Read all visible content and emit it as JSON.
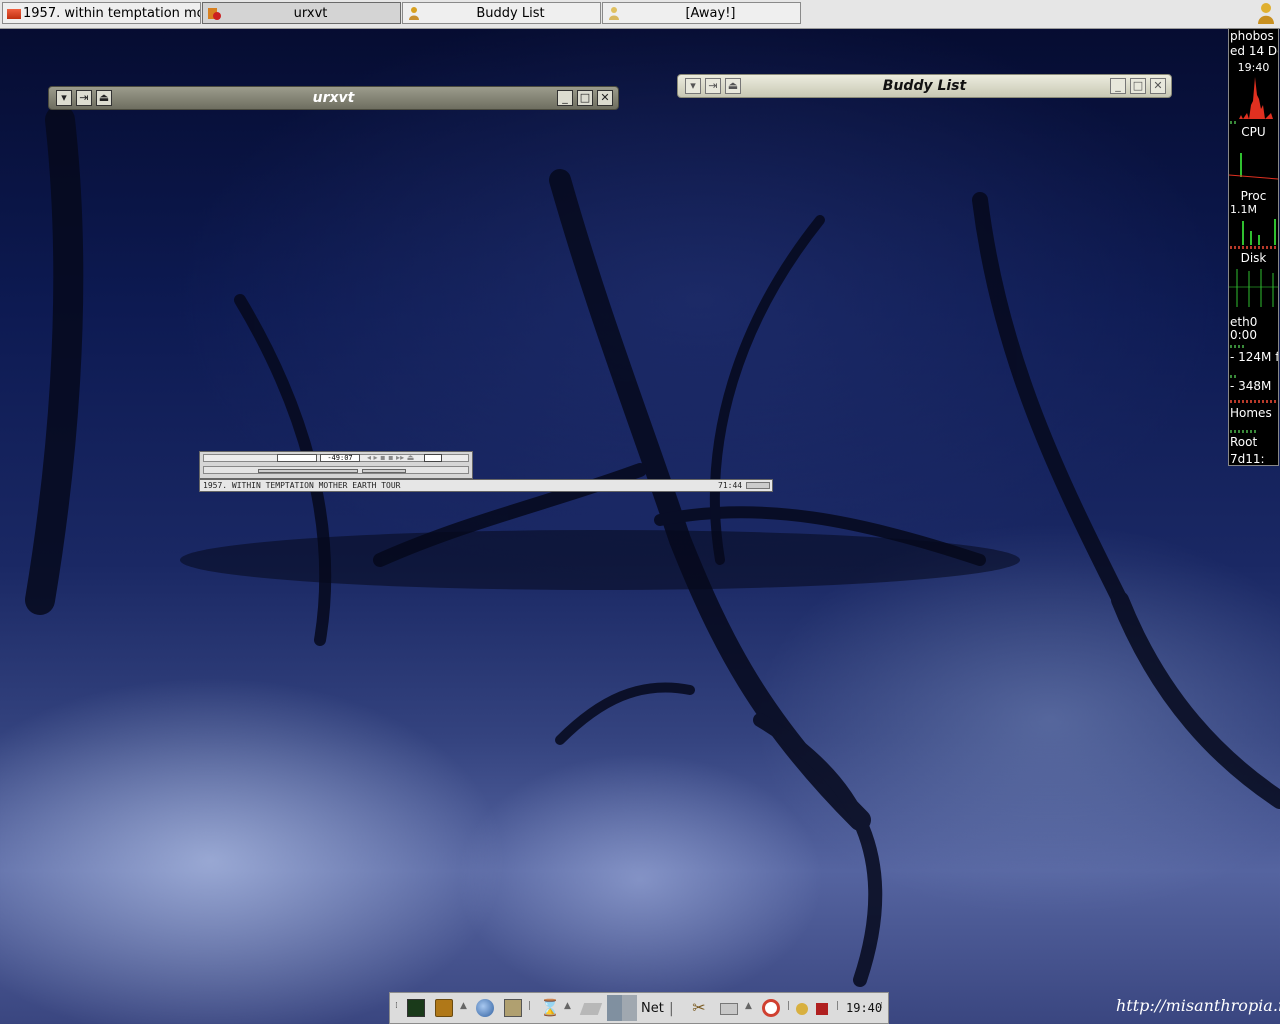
{
  "taskbar": {
    "tasks": [
      {
        "label": "1957. within temptation mothe",
        "icon": "xmms-icon"
      },
      {
        "label": "urxvt",
        "icon": "terminal-icon"
      },
      {
        "label": "Buddy List",
        "icon": "buddy-icon"
      },
      {
        "label": "[Away!]",
        "icon": "buddy-icon"
      }
    ]
  },
  "windows": {
    "urxvt": {
      "title": "urxvt"
    },
    "buddy": {
      "title": "Buddy List"
    }
  },
  "gkrellm": {
    "host": "phobos",
    "date": "ed 14 De",
    "time": "19:40",
    "cpu_label": "CPU",
    "proc_label": "Proc",
    "proc_value": "1.1M",
    "disk_label": "Disk",
    "net_label": "eth0",
    "net_time": "0:00",
    "mem": "- 124M f",
    "swap": "- 348M",
    "fs1": "Homes",
    "fs2": "Root",
    "uptime": "7d11:"
  },
  "xmms": {
    "time": "-49:07",
    "playlist_entry": "1957. WITHIN TEMPTATION MOTHER EARTH TOUR",
    "playlist_duration": "71:44"
  },
  "dock": {
    "net_label": "Net",
    "clock": "19:40"
  },
  "watermark": "http://misanthropia.net",
  "colors": {
    "cpu_graph": "#e03020",
    "graph_green": "#30c030",
    "taskbar_bg": "#e6e6e6"
  }
}
